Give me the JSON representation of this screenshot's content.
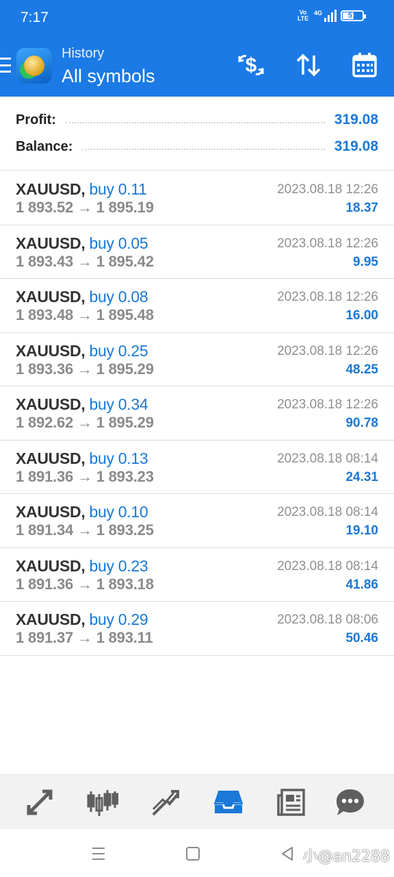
{
  "status_bar": {
    "time": "7:17",
    "volte_line1": "Vo",
    "volte_line2": "LTE",
    "network": "4G",
    "battery": "51"
  },
  "header": {
    "subtitle": "History",
    "title": "All symbols",
    "icons": [
      "menu-icon",
      "app-logo",
      "currency-exchange-icon",
      "sort-icon",
      "calendar-icon"
    ]
  },
  "summary": {
    "profit_label": "Profit:",
    "profit_value": "319.08",
    "balance_label": "Balance:",
    "balance_value": "319.08"
  },
  "deals": [
    {
      "symbol": "XAUUSD,",
      "side": "buy 0.11",
      "open": "1 893.52",
      "close": "1 895.19",
      "time": "2023.08.18 12:26",
      "profit": "18.37"
    },
    {
      "symbol": "XAUUSD,",
      "side": "buy 0.05",
      "open": "1 893.43",
      "close": "1 895.42",
      "time": "2023.08.18 12:26",
      "profit": "9.95"
    },
    {
      "symbol": "XAUUSD,",
      "side": "buy 0.08",
      "open": "1 893.48",
      "close": "1 895.48",
      "time": "2023.08.18 12:26",
      "profit": "16.00"
    },
    {
      "symbol": "XAUUSD,",
      "side": "buy 0.25",
      "open": "1 893.36",
      "close": "1 895.29",
      "time": "2023.08.18 12:26",
      "profit": "48.25"
    },
    {
      "symbol": "XAUUSD,",
      "side": "buy 0.34",
      "open": "1 892.62",
      "close": "1 895.29",
      "time": "2023.08.18 12:26",
      "profit": "90.78"
    },
    {
      "symbol": "XAUUSD,",
      "side": "buy 0.13",
      "open": "1 891.36",
      "close": "1 893.23",
      "time": "2023.08.18 08:14",
      "profit": "24.31"
    },
    {
      "symbol": "XAUUSD,",
      "side": "buy 0.10",
      "open": "1 891.34",
      "close": "1 893.25",
      "time": "2023.08.18 08:14",
      "profit": "19.10"
    },
    {
      "symbol": "XAUUSD,",
      "side": "buy 0.23",
      "open": "1 891.36",
      "close": "1 893.18",
      "time": "2023.08.18 08:14",
      "profit": "41.86"
    },
    {
      "symbol": "XAUUSD,",
      "side": "buy 0.29",
      "open": "1 891.37",
      "close": "1 893.11",
      "time": "2023.08.18 08:06",
      "profit": "50.46"
    }
  ],
  "arrow": "→",
  "bottom_nav": {
    "items": [
      "quotes-icon",
      "chart-icon",
      "trade-icon",
      "history-icon",
      "news-icon",
      "chat-icon"
    ],
    "active": "history-icon"
  },
  "system_nav": {
    "items": [
      "recents-icon",
      "home-icon",
      "back-icon"
    ]
  },
  "watermark": "小@an2288",
  "colors": {
    "header_bg": "#1b7ae6",
    "accent": "#1a78d6",
    "text_dark": "#333333",
    "text_muted": "#8a8a8a"
  }
}
